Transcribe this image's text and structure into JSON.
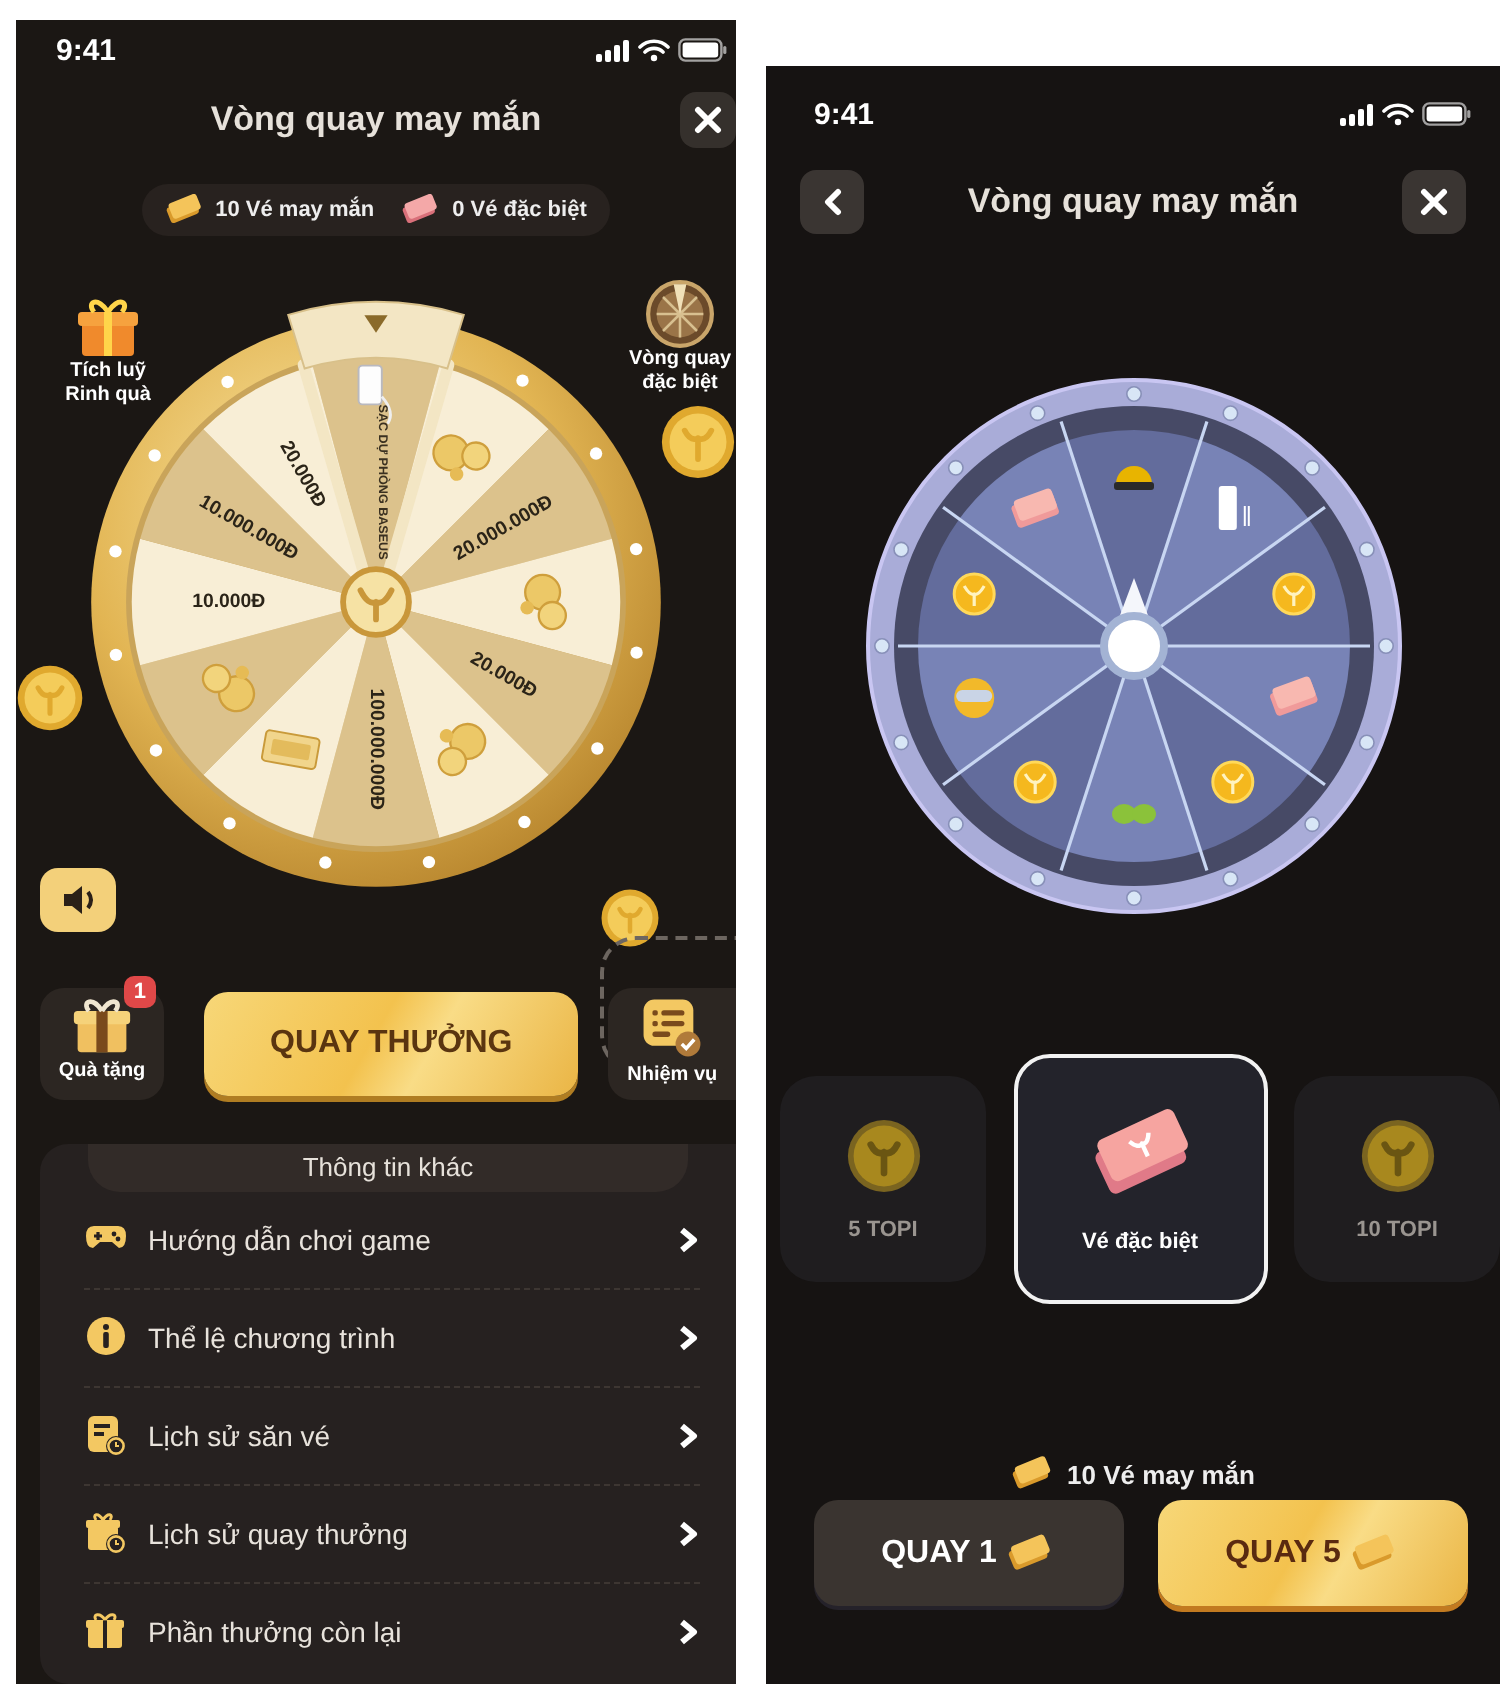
{
  "lucky_wheel_screen": {
    "status_bar": {
      "time": "9:41"
    },
    "title": "Vòng quay may mắn",
    "tickets": [
      {
        "kind": "lucky",
        "label": "10 Vé may mắn"
      },
      {
        "kind": "special",
        "label": "0 Vé đặc biệt"
      }
    ],
    "shortcuts": [
      {
        "kind": "gift",
        "label": "Tích luỹ Rinh quà"
      },
      {
        "kind": "wheel",
        "label": "Vòng quay đặc biệt"
      }
    ],
    "wheel": {
      "segments": [
        {
          "kind": "powerbank",
          "label": "SẠC DỰ PHÒNG BASEUS"
        },
        {
          "kind": "coins"
        },
        {
          "kind": "text",
          "label": "20.000.000Đ"
        },
        {
          "kind": "coins"
        },
        {
          "kind": "text",
          "label": "20.000Đ"
        },
        {
          "kind": "coins"
        },
        {
          "kind": "text",
          "label": "100.000.000Đ"
        },
        {
          "kind": "ticket"
        },
        {
          "kind": "coins"
        },
        {
          "kind": "text",
          "label": "10.000Đ"
        },
        {
          "kind": "text",
          "label": "10.000.000Đ"
        },
        {
          "kind": "text",
          "label": "20.000Đ"
        }
      ]
    },
    "gifts": {
      "label": "Quà tặng",
      "badge": "1"
    },
    "spin_button": "QUAY THƯỞNG",
    "missions": {
      "label": "Nhiệm vụ"
    },
    "info_panel": {
      "title": "Thông tin khác",
      "items": [
        {
          "kind": "gamepad",
          "label": "Hướng dẫn chơi game"
        },
        {
          "kind": "info",
          "label": "Thể lệ chương trình"
        },
        {
          "kind": "ticket_history",
          "label": "Lịch sử săn vé"
        },
        {
          "kind": "spin_history",
          "label": "Lịch sử quay thưởng"
        },
        {
          "kind": "gift",
          "label": "Phần thưởng còn lại"
        }
      ]
    }
  },
  "special_wheel_screen": {
    "status_bar": {
      "time": "9:41"
    },
    "title": "Vòng quay may mắn",
    "wheel": {
      "segments": [
        {
          "kind": "helmet"
        },
        {
          "kind": "powerbank"
        },
        {
          "kind": "coin"
        },
        {
          "kind": "ticket"
        },
        {
          "kind": "coin"
        },
        {
          "kind": "toy"
        },
        {
          "kind": "coin"
        },
        {
          "kind": "mascot"
        },
        {
          "kind": "coin"
        },
        {
          "kind": "ticket"
        }
      ]
    },
    "rewards": [
      {
        "kind": "coin",
        "label": "5 TOPI",
        "selected": false
      },
      {
        "kind": "ticket",
        "label": "Vé đặc biệt",
        "selected": true
      },
      {
        "kind": "coin",
        "label": "10 TOPI",
        "selected": false
      }
    ],
    "ticket_balance": "10 Vé may mắn",
    "spin_buttons": [
      {
        "kind": "secondary",
        "label": "QUAY 1"
      },
      {
        "kind": "primary",
        "label": "QUAY 5"
      }
    ]
  }
}
